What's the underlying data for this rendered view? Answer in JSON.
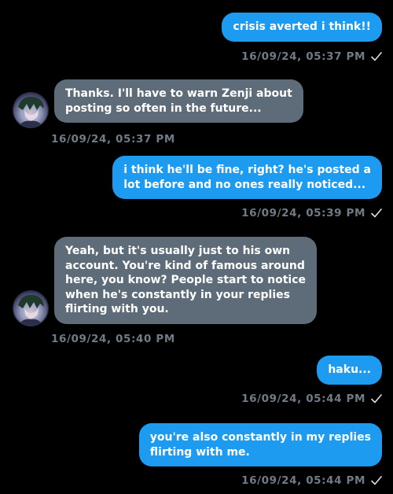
{
  "messages": [
    {
      "direction": "out",
      "text": "crisis averted i think!!",
      "timestamp": "16/09/24, 05:37 PM",
      "status": "read"
    },
    {
      "direction": "in",
      "text": "Thanks. I'll have to warn Zenji about\nposting so often in the future...",
      "timestamp": "16/09/24, 05:37 PM"
    },
    {
      "direction": "out",
      "text": "i think he'll be fine, right? he's posted a\nlot before and no ones really noticed...",
      "timestamp": "16/09/24, 05:39 PM",
      "status": "read"
    },
    {
      "direction": "in",
      "text": "Yeah, but it's usually just to his own\naccount. You're kind of famous around\nhere, you know? People start to notice\nwhen he's constantly in your replies\nflirting with you.",
      "timestamp": "16/09/24, 05:40 PM"
    },
    {
      "direction": "out",
      "text": "haku...",
      "timestamp": "16/09/24, 05:44 PM",
      "status": "read"
    },
    {
      "direction": "out",
      "text": "you're also constantly in my replies\nflirting with me.",
      "timestamp": "16/09/24, 05:44 PM",
      "status": "read"
    }
  ],
  "colors": {
    "outgoing_bubble": "#1d9bf0",
    "incoming_bubble": "#5e6c79",
    "timestamp": "#6f7b86",
    "background": "#000000"
  },
  "icons": {
    "read_receipt": "check-icon",
    "contact_avatar": "avatar"
  }
}
